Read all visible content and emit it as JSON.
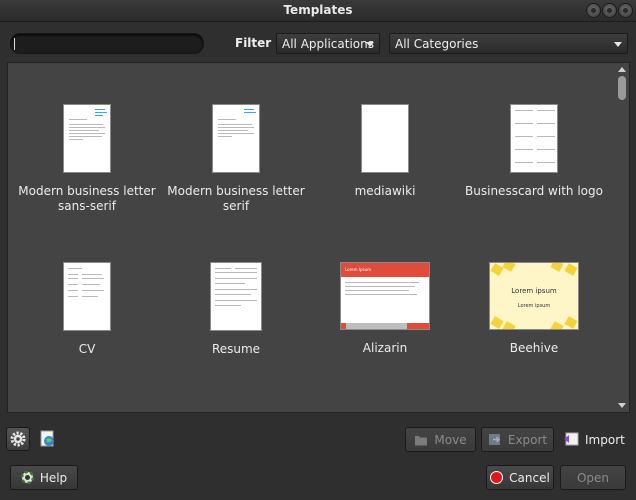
{
  "window": {
    "title": "Templates"
  },
  "search": {
    "value": "",
    "placeholder": ""
  },
  "filter": {
    "label": "Filter",
    "application": "All Applications",
    "category": "All Categories"
  },
  "templates": [
    {
      "name": "Modern business letter sans-serif"
    },
    {
      "name": "Modern business letter serif"
    },
    {
      "name": "mediawiki"
    },
    {
      "name": "Businesscard with logo"
    },
    {
      "name": "CV"
    },
    {
      "name": "Resume"
    },
    {
      "name": "Alizarin",
      "thumb_title": "Lorem Ipsum"
    },
    {
      "name": "Beehive",
      "thumb_title": "Lorem ipsum",
      "thumb_subtitle": "Lorem ipsum"
    }
  ],
  "toolbar": {
    "settings_icon": "gear-icon",
    "online_icon": "globe-document-icon",
    "move_label": "Move",
    "export_label": "Export",
    "import_label": "Import"
  },
  "footer": {
    "help_label": "Help",
    "cancel_label": "Cancel",
    "open_label": "Open"
  },
  "colors": {
    "background": "#2f2f2f",
    "view": "#444444",
    "alizarin": "#e04b3c",
    "beehive": "#f5d23a",
    "cancel_red": "#e0161a"
  }
}
